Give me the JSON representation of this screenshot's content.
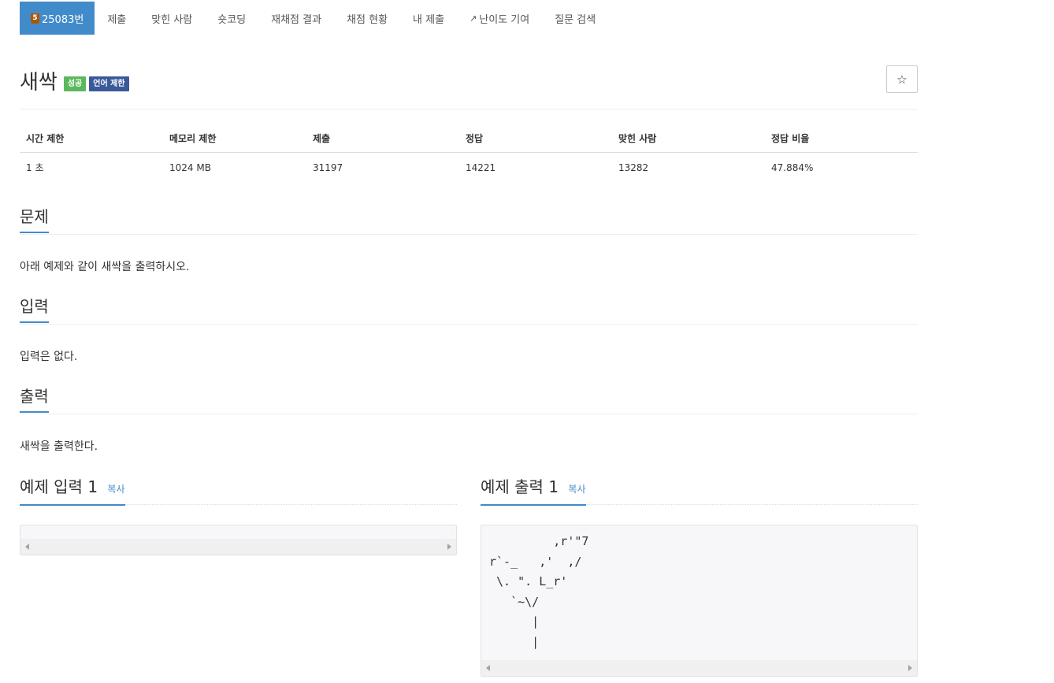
{
  "nav": {
    "problem_number": "25083번",
    "tier_badge": "5",
    "items": [
      "제출",
      "맞힌 사람",
      "숏코딩",
      "재채점 결과",
      "채점 현황",
      "내 제출",
      "난이도 기여",
      "질문 검색"
    ]
  },
  "problem": {
    "title": "새싹",
    "labels": [
      "성공",
      "언어 제한"
    ],
    "star": "☆"
  },
  "info_table": {
    "headers": [
      "시간 제한",
      "메모리 제한",
      "제출",
      "정답",
      "맞힌 사람",
      "정답 비율"
    ],
    "values": [
      "1 초",
      "1024 MB",
      "31197",
      "14221",
      "13282",
      "47.884%"
    ]
  },
  "sections": {
    "description": {
      "title": "문제",
      "text": "아래 예제와 같이 새싹을 출력하시오."
    },
    "input": {
      "title": "입력",
      "text": "입력은 없다."
    },
    "output": {
      "title": "출력",
      "text": "새싹을 출력한다."
    }
  },
  "samples": {
    "input": {
      "title": "예제 입력 1",
      "copy": "복사",
      "content": ""
    },
    "output": {
      "title": "예제 출력 1",
      "copy": "복사",
      "content": "         ,r'\"7\nr`-_   ,'  ,/\n \\. \". L_r'\n   `~\\/\n      |\n      |"
    }
  },
  "colors": {
    "primary": "#428bca",
    "success": "#5cb85c",
    "language": "#3b5998",
    "tier_bronze": "#ad5600"
  }
}
